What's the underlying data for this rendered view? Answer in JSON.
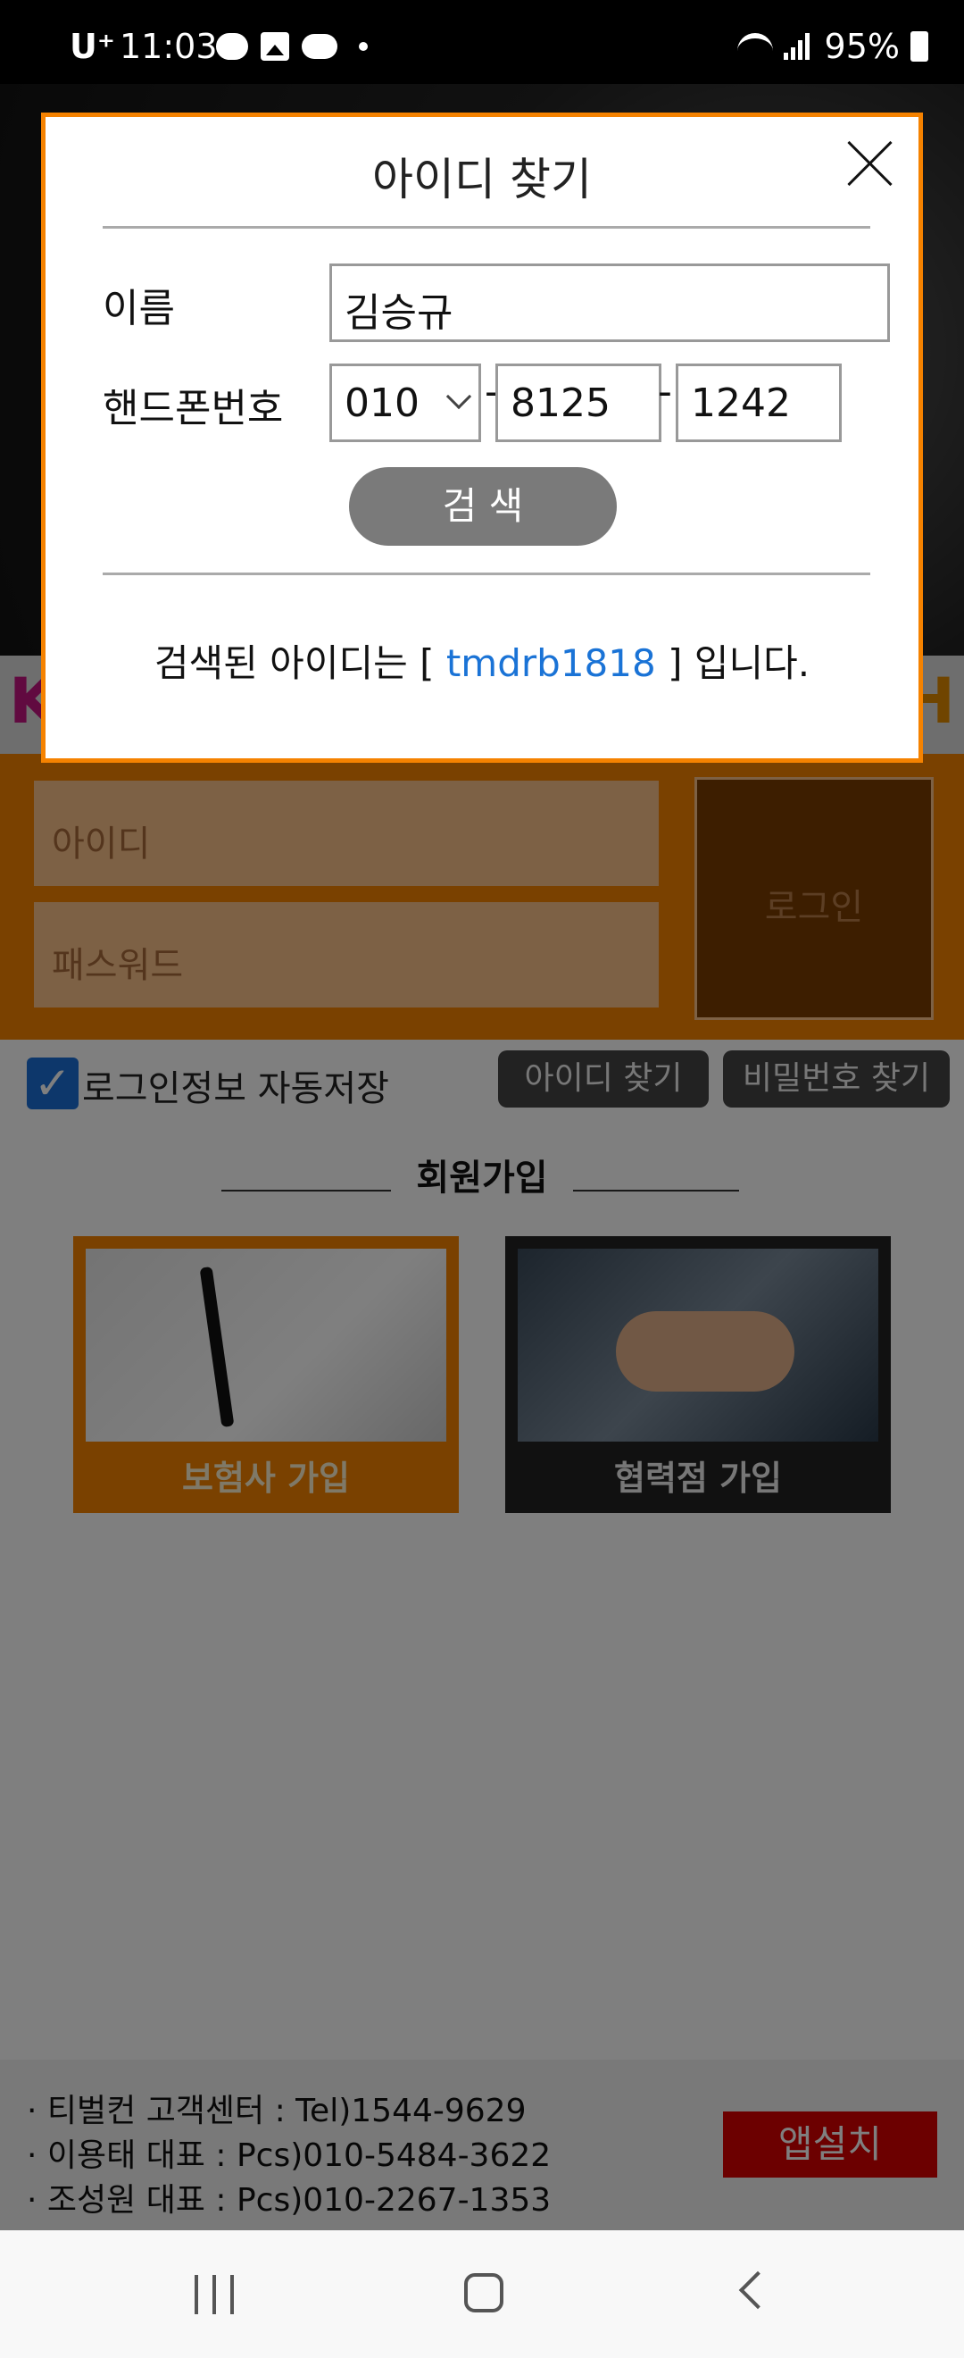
{
  "status_bar": {
    "carrier": "U⁺",
    "time": "11:03",
    "battery": "95%",
    "icons": [
      "chat-icon",
      "image-icon",
      "cloud-icon",
      "dot-icon",
      "wifi-icon",
      "signal-icon",
      "battery-icon"
    ]
  },
  "hero": {
    "left_mark": "K",
    "right_mark": "H"
  },
  "login": {
    "id_placeholder": "아이디",
    "pw_placeholder": "패스워드",
    "login_button": "로그인"
  },
  "options": {
    "auto_save_label": "로그인정보 자동저장",
    "auto_save_checked": true,
    "find_id_button": "아이디 찾기",
    "find_pw_button": "비밀번호 찾기"
  },
  "signup": {
    "title": "회원가입",
    "insurer_label": "보험사 가입",
    "partner_label": "협력점 가입"
  },
  "footer": {
    "line1": "· 티벌컨 고객센터 : Tel)1544-9629",
    "line2": "· 이용태 대표 : Pcs)010-5484-3622",
    "line3": "· 조성원 대표 : Pcs)010-2267-1353",
    "install_button": "앱설치"
  },
  "modal": {
    "title": "아이디 찾기",
    "name_label": "이름",
    "name_value": "김승규",
    "phone_label": "핸드폰번호",
    "phone_prefix": "010",
    "phone_mid": "8125",
    "phone_last": "1242",
    "dash": "-",
    "search_button": "검 색",
    "result_prefix": "검색된 아이디는 [",
    "result_id": "tmdrb1818",
    "result_suffix": "] 입니다."
  },
  "colors": {
    "accent": "#f58200",
    "link": "#1a73d6",
    "install": "#d90000",
    "check": "#1b6fd6"
  }
}
